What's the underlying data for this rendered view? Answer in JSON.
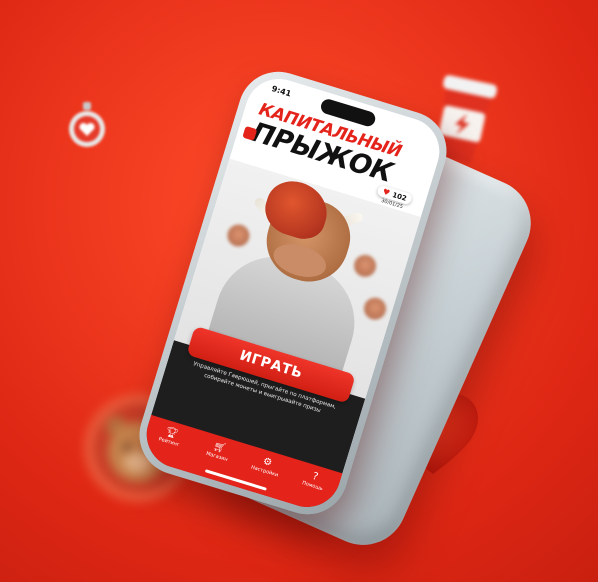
{
  "phone": {
    "time": "9:41",
    "title_line1": "КАПИТАЛЬНЫЙ",
    "title_line2": "ПРЫЖОК",
    "score": "102",
    "score_date": "30/01/25",
    "play_button": "ИГРАТЬ",
    "description": "Управляйте Гаврюшей, прыгайте по платформам, собирайте монеты и выигрывайте призы",
    "tabs": [
      {
        "label": "Рейтинг",
        "icon": "trophy-icon"
      },
      {
        "label": "Магазин",
        "icon": "cart-icon"
      },
      {
        "label": "Настройки",
        "icon": "gear-icon"
      },
      {
        "label": "Помощь",
        "icon": "question-icon"
      }
    ]
  },
  "colors": {
    "background": "#ef3a1f",
    "accent": "#e4231b",
    "dark_panel": "#1e1e1e"
  }
}
